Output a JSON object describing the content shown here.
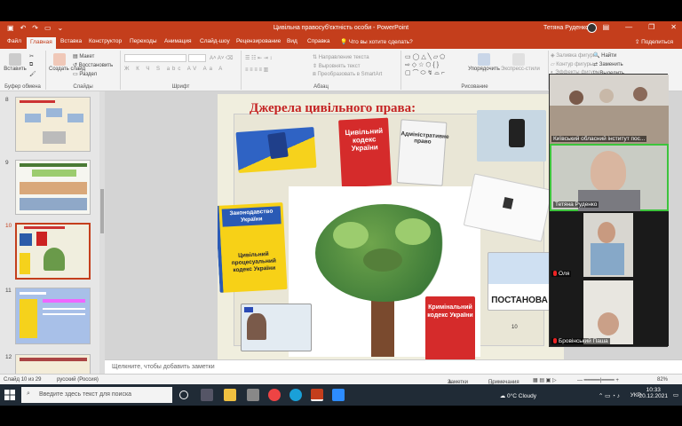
{
  "window": {
    "title": "Цивільна правосуб'єктність особи - PowerPoint",
    "user": "Тетяна Руденко"
  },
  "tabs": [
    "Файл",
    "Главная",
    "Вставка",
    "Конструктор",
    "Переходы",
    "Анимация",
    "Слайд-шоу",
    "Рецензирование",
    "Вид",
    "Справка",
    "Что вы хотите сделать?"
  ],
  "share_label": "Поделиться",
  "ribbon": {
    "clipboard_label": "Буфер обмена",
    "paste": "Вставить",
    "slides_label": "Слайды",
    "new_slide": "Создать слайд",
    "layout": "Макет",
    "reset": "Восстановить",
    "section": "Раздел",
    "font_label": "Шрифт",
    "paragraph_label": "Абзац",
    "text_direction": "Направление текста",
    "align_text": "Выровнять текст",
    "smartart": "Преобразовать в SmartArt",
    "drawing_label": "Рисование",
    "arrange": "Упорядочить",
    "quick_styles": "Экспресс-стили",
    "shape_fill": "Заливка фигуры",
    "shape_outline": "Контур фигуры",
    "shape_effects": "Эффекты фигуры",
    "find": "Найти",
    "replace": "Заменить",
    "select": "Выделить"
  },
  "slides_panel": {
    "numbers": [
      "8",
      "9",
      "10",
      "11",
      "12"
    ]
  },
  "slide": {
    "title": "Джерела цивільного права:",
    "books": [
      "Цивільний кодекс України",
      "Законодавство України",
      "Цивільний процесуальний кодекс України",
      "Кримінальний кодекс України",
      "Адміністративне право"
    ],
    "sign": "ПОСТАНОВА",
    "page_number": "10"
  },
  "notes_placeholder": "Щелкните, чтобы добавить заметки",
  "status": {
    "slide_info": "Слайд 10 из 29",
    "language": "русский (Россия)",
    "notes": "Заметки",
    "comments": "Примечания",
    "zoom": "82%"
  },
  "video": {
    "tiles": [
      {
        "name": "Київський обласний інститут пос..."
      },
      {
        "name": "Тетяна Руденко"
      },
      {
        "name": "Оля"
      },
      {
        "name": "Бровінський Паша"
      }
    ]
  },
  "taskbar": {
    "search_placeholder": "Введите здесь текст для поиска",
    "weather": "0°C Cloudy",
    "lang": "УКР",
    "time": "10:33",
    "date": "20.12.2021"
  }
}
